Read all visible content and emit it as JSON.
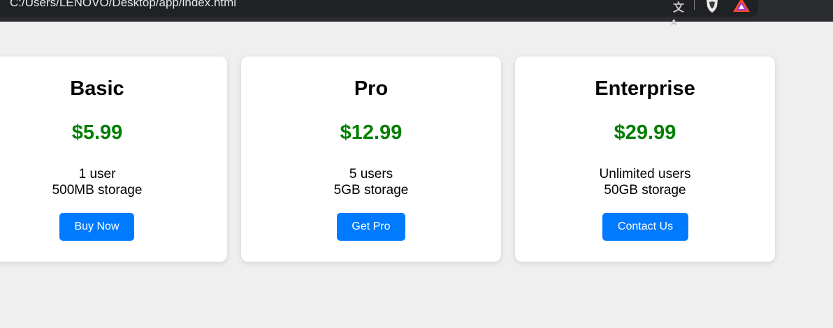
{
  "browser": {
    "url": "C:/Users/LENOVO/Desktop/app/index.html",
    "icons": [
      "translate-icon",
      "brave-shield-icon",
      "brave-rewards-icon"
    ]
  },
  "plans": [
    {
      "name": "Basic",
      "price": "$5.99",
      "features": [
        "1 user",
        "500MB storage"
      ],
      "button_label": "Buy Now"
    },
    {
      "name": "Pro",
      "price": "$12.99",
      "features": [
        "5 users",
        "5GB storage"
      ],
      "button_label": "Get Pro"
    },
    {
      "name": "Enterprise",
      "price": "$29.99",
      "features": [
        "Unlimited users",
        "50GB storage"
      ],
      "button_label": "Contact Us"
    }
  ],
  "colors": {
    "page_background": "#efefef",
    "card_background": "#ffffff",
    "price": "#008000",
    "button": "#007bff",
    "button_text": "#ffffff",
    "browser_bar": "#202124"
  }
}
